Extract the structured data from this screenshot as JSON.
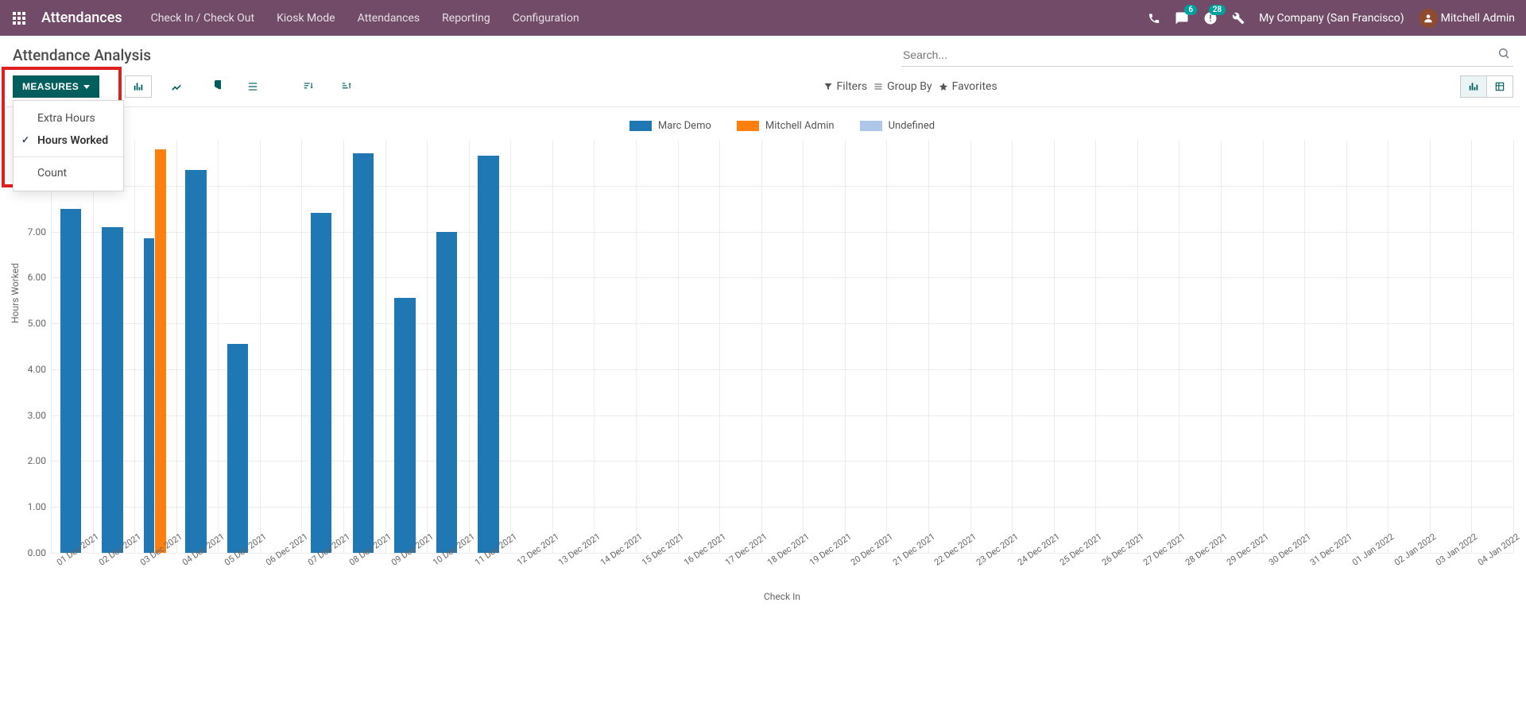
{
  "brand": "Attendances",
  "nav": {
    "items": [
      "Check In / Check Out",
      "Kiosk Mode",
      "Attendances",
      "Reporting",
      "Configuration"
    ]
  },
  "header_right": {
    "messages_badge": "6",
    "activities_badge": "28",
    "company": "My Company (San Francisco)",
    "user": "Mitchell Admin"
  },
  "page_title": "Attendance Analysis",
  "search": {
    "placeholder": "Search..."
  },
  "toolbar": {
    "measures_label": "MEASURES",
    "filters_label": "Filters",
    "group_by_label": "Group By",
    "favorites_label": "Favorites"
  },
  "measures_dropdown": {
    "items": [
      {
        "label": "Extra Hours",
        "selected": false
      },
      {
        "label": "Hours Worked",
        "selected": true
      },
      {
        "label": "Count",
        "selected": false,
        "separated": true
      }
    ]
  },
  "chart_data": {
    "type": "bar",
    "title": "",
    "ylabel": "Hours Worked",
    "xlabel": "Check In",
    "ylim": [
      0,
      9
    ],
    "yticks": [
      0.0,
      1.0,
      2.0,
      3.0,
      4.0,
      5.0,
      6.0,
      7.0,
      8.0
    ],
    "categories": [
      "01 Dec 2021",
      "02 Dec 2021",
      "03 Dec 2021",
      "04 Dec 2021",
      "05 Dec 2021",
      "06 Dec 2021",
      "07 Dec 2021",
      "08 Dec 2021",
      "09 Dec 2021",
      "10 Dec 2021",
      "11 Dec 2021",
      "12 Dec 2021",
      "13 Dec 2021",
      "14 Dec 2021",
      "15 Dec 2021",
      "16 Dec 2021",
      "17 Dec 2021",
      "18 Dec 2021",
      "19 Dec 2021",
      "20 Dec 2021",
      "21 Dec 2021",
      "22 Dec 2021",
      "23 Dec 2021",
      "24 Dec 2021",
      "25 Dec 2021",
      "26 Dec 2021",
      "27 Dec 2021",
      "28 Dec 2021",
      "29 Dec 2021",
      "30 Dec 2021",
      "31 Dec 2021",
      "01 Jan 2022",
      "02 Jan 2022",
      "03 Jan 2022",
      "04 Jan 2022"
    ],
    "series": [
      {
        "name": "Marc Demo",
        "color": "#1F77B4",
        "values": [
          7.5,
          7.1,
          6.85,
          8.35,
          4.55,
          null,
          7.4,
          8.7,
          5.55,
          7.0,
          8.65,
          null,
          null,
          null,
          null,
          null,
          null,
          null,
          null,
          null,
          null,
          null,
          null,
          null,
          null,
          null,
          null,
          null,
          null,
          null,
          null,
          null,
          null,
          null,
          null
        ]
      },
      {
        "name": "Mitchell Admin",
        "color": "#FF7F0E",
        "values": [
          null,
          null,
          8.8,
          null,
          null,
          null,
          null,
          null,
          null,
          null,
          null,
          null,
          null,
          null,
          null,
          null,
          null,
          null,
          null,
          null,
          null,
          null,
          null,
          null,
          null,
          null,
          null,
          null,
          null,
          null,
          null,
          null,
          null,
          null,
          null
        ]
      },
      {
        "name": "Undefined",
        "color": "#AEC7E8",
        "values": [
          null,
          null,
          null,
          null,
          null,
          null,
          null,
          null,
          null,
          null,
          null,
          null,
          null,
          null,
          null,
          null,
          null,
          null,
          null,
          null,
          null,
          null,
          null,
          null,
          null,
          null,
          null,
          null,
          null,
          null,
          null,
          null,
          null,
          null,
          null
        ]
      }
    ]
  },
  "colors": {
    "topnav_bg": "#714B67",
    "accent": "#005E5D",
    "series1": "#1F77B4",
    "series2": "#FF7F0E",
    "series3": "#AEC7E8",
    "badge_bg": "#00A09D",
    "highlight": "#E02020"
  }
}
